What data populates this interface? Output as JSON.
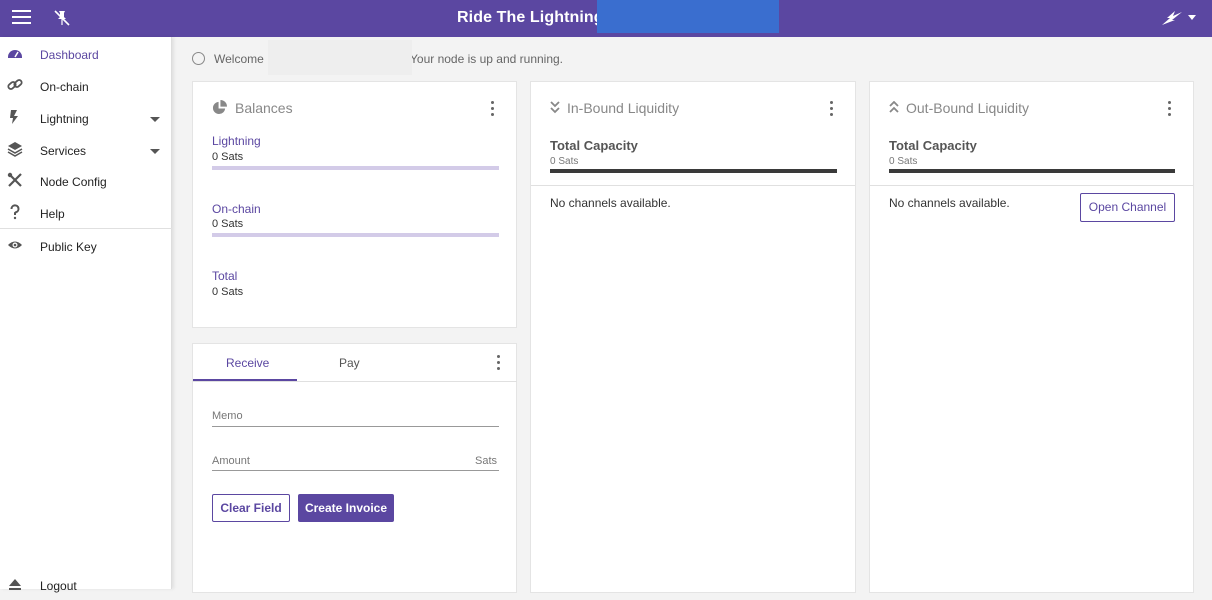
{
  "header": {
    "title": "Ride The Lightning -"
  },
  "sidebar": {
    "items": [
      {
        "label": "Dashboard",
        "icon": "dashboard-icon"
      },
      {
        "label": "On-chain",
        "icon": "link-icon"
      },
      {
        "label": "Lightning",
        "icon": "bolt-icon"
      },
      {
        "label": "Services",
        "icon": "layers-icon"
      },
      {
        "label": "Node Config",
        "icon": "tools-icon"
      },
      {
        "label": "Help",
        "icon": "help-icon"
      },
      {
        "label": "Public Key",
        "icon": "eye-icon"
      }
    ],
    "logout": "Logout"
  },
  "welcome": {
    "prefix": "Welcome",
    "suffix": "Your node is up and running."
  },
  "balances": {
    "title": "Balances",
    "lightning_label": "Lightning",
    "lightning_value": "0 Sats",
    "onchain_label": "On-chain",
    "onchain_value": "0 Sats",
    "total_label": "Total",
    "total_value": "0 Sats"
  },
  "transactions": {
    "tabs": [
      "Receive",
      "Pay"
    ],
    "memo_placeholder": "Memo",
    "amount_placeholder": "Amount",
    "amount_suffix": "Sats",
    "clear_label": "Clear Field",
    "create_label": "Create Invoice"
  },
  "inbound": {
    "title": "In-Bound Liquidity",
    "capacity_label": "Total Capacity",
    "capacity_value": "0 Sats",
    "empty": "No channels available."
  },
  "outbound": {
    "title": "Out-Bound Liquidity",
    "capacity_label": "Total Capacity",
    "capacity_value": "0 Sats",
    "empty": "No channels available.",
    "open_channel_label": "Open Channel"
  },
  "colors": {
    "primary": "#5b47a1",
    "accent_blue": "#3a6ecf"
  }
}
